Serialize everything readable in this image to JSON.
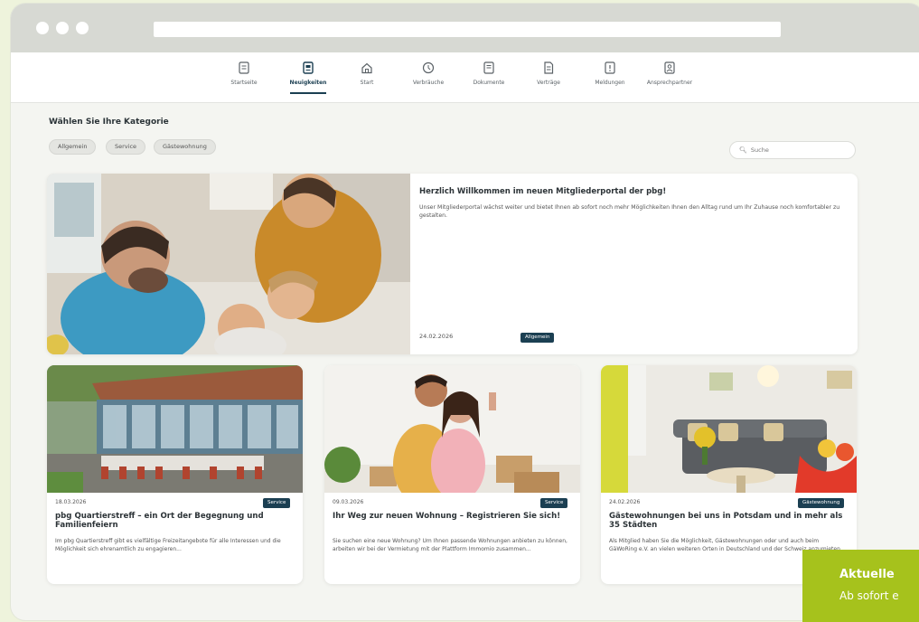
{
  "nav": {
    "items": [
      {
        "label": "Startseite",
        "icon": "document-icon"
      },
      {
        "label": "Neuigkeiten",
        "icon": "news-icon",
        "active": true
      },
      {
        "label": "Start",
        "icon": "home-icon"
      },
      {
        "label": "Verbräuche",
        "icon": "consumption-icon"
      },
      {
        "label": "Dokumente",
        "icon": "document-icon"
      },
      {
        "label": "Verträge",
        "icon": "contract-icon"
      },
      {
        "label": "Meldungen",
        "icon": "report-icon"
      },
      {
        "label": "Ansprechpartner",
        "icon": "contact-icon"
      }
    ]
  },
  "category": {
    "title": "Wählen Sie Ihre Kategorie",
    "chips": [
      "Allgemein",
      "Service",
      "Gästewohnung"
    ]
  },
  "search": {
    "placeholder": "Suche"
  },
  "hero": {
    "title": "Herzlich Willkommen im neuen Mitgliederportal der pbg!",
    "text": "Unser Mitgliederportal wächst weiter und bietet Ihnen ab sofort noch mehr Möglichkeiten Ihnen den Alltag rund um Ihr Zuhause noch komfortabler zu gestalten.",
    "date": "24.02.2026",
    "badge": "Allgemein"
  },
  "cards": [
    {
      "date": "18.03.2026",
      "badge": "Service",
      "title": "pbg Quartierstreff – ein Ort der Begegnung und Familienfeiern",
      "text": "Im pbg Quartierstreff gibt es vielfältige Freizeitangebote für alle Interessen und die Möglichkeit sich ehrenamtlich zu engagieren..."
    },
    {
      "date": "09.03.2026",
      "badge": "Service",
      "title": "Ihr Weg zur neuen Wohnung – Registrieren Sie sich!",
      "text": "Sie suchen eine neue Wohnung? Um Ihnen passende Wohnungen anbieten zu können, arbeiten wir bei der Vermietung mit der Plattform Immomio zusammen..."
    },
    {
      "date": "24.02.2026",
      "badge": "Gästewohnung",
      "title": "Gästewohnungen bei uns in Potsdam und in mehr als 35 Städten",
      "text": "Als Mitglied haben Sie die Möglichkeit, Gästewohnungen oder und auch beim GäWoRing e.V. an vielen weiteren Orten in Deutschland und der Schweiz anzumieten."
    }
  ],
  "toast": {
    "title": "Aktuelle",
    "text": "Ab sofort e"
  },
  "colors": {
    "accent": "#1b3f52",
    "toast": "#a6c21c"
  }
}
